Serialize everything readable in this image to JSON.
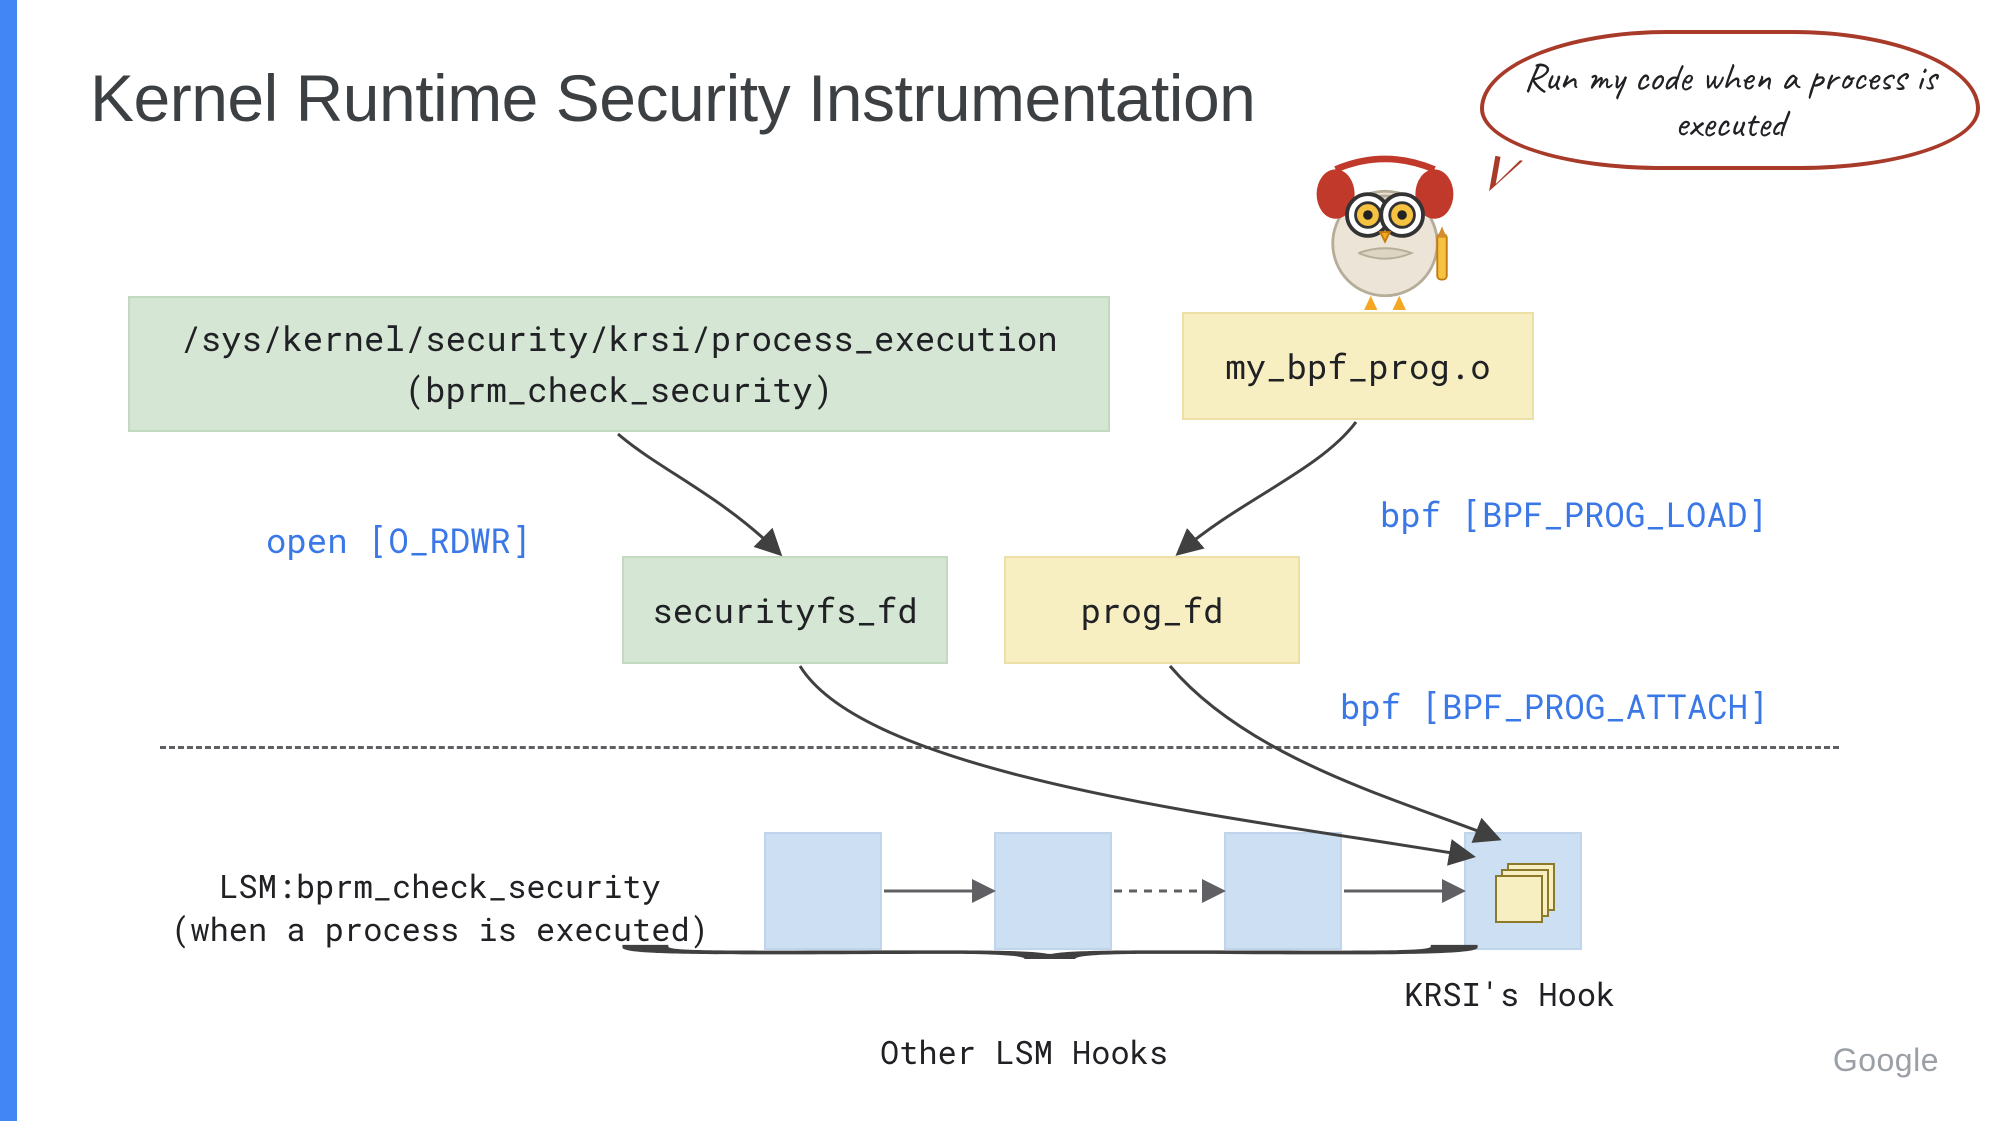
{
  "title": "Kernel Runtime Security Instrumentation",
  "speech_text": "Run my code when a process is executed",
  "box_krsi_path": {
    "line1": "/sys/kernel/security/krsi/process_execution",
    "line2": "(bprm_check_security)"
  },
  "box_bpf_prog": "my_bpf_prog.o",
  "box_securityfs_fd": "securityfs_fd",
  "box_prog_fd": "prog_fd",
  "label_open": "open [O_RDWR]",
  "label_load": "bpf [BPF_PROG_LOAD]",
  "label_attach": "bpf [BPF_PROG_ATTACH]",
  "lsm_label": {
    "line1": "LSM:bprm_check_security",
    "line2": "(when a process is executed)"
  },
  "other_hooks_label": "Other LSM Hooks",
  "krsi_hook_label": "KRSI's Hook",
  "brand": "Google"
}
